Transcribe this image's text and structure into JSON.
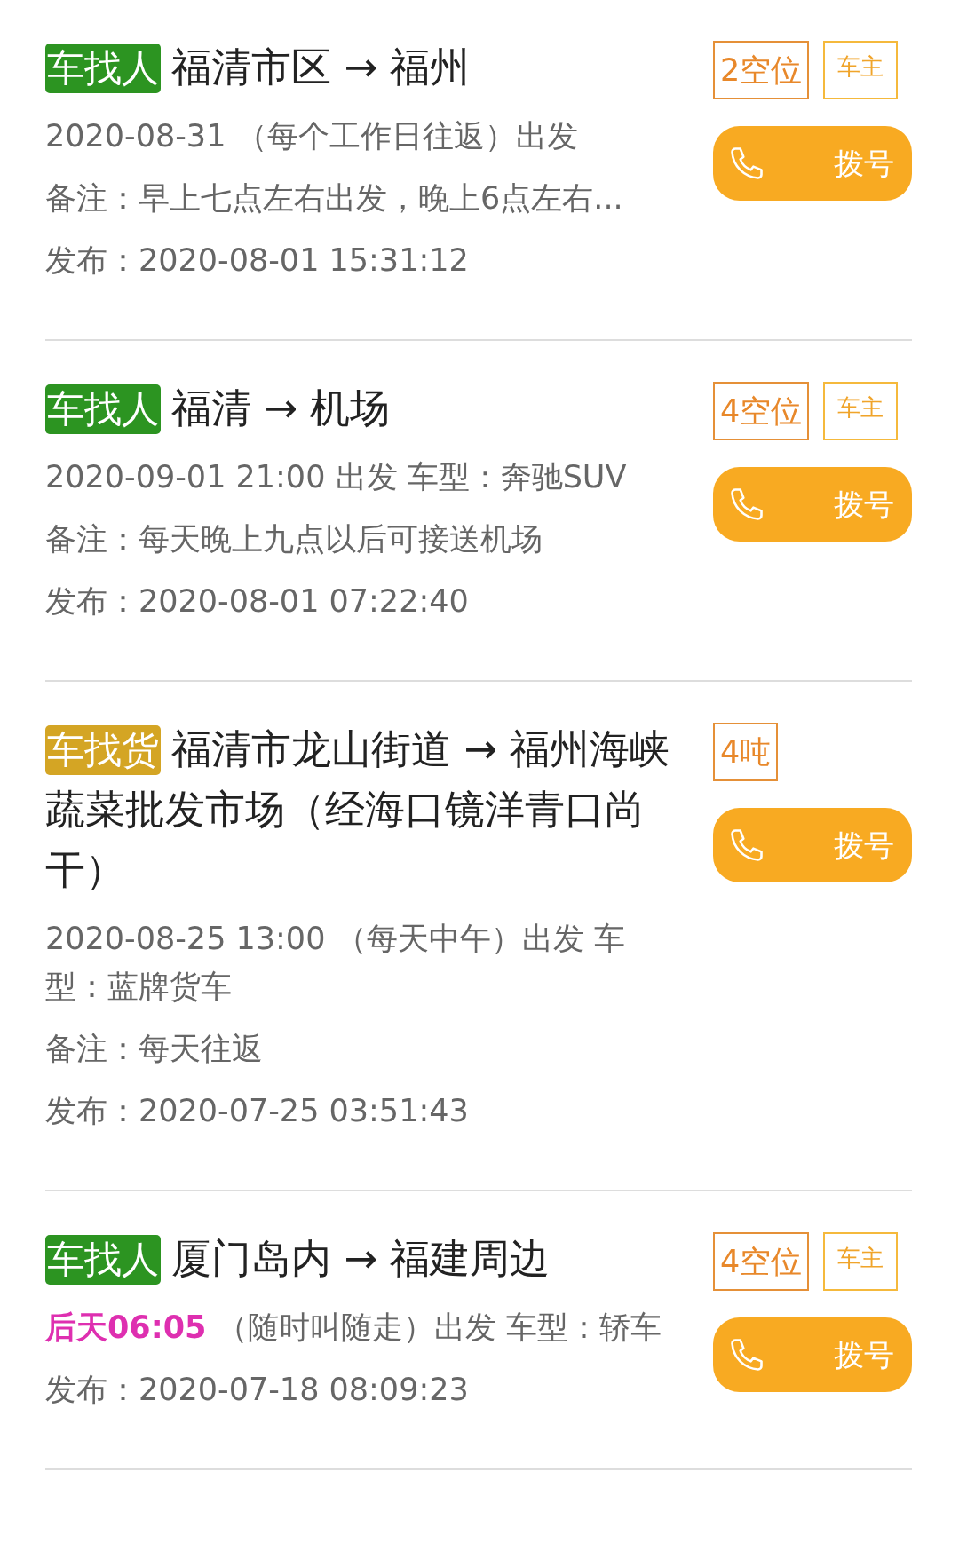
{
  "listings": [
    {
      "tag": {
        "text": "车找人",
        "kind": "passenger"
      },
      "route": "福清市区 → 福州",
      "badges": [
        {
          "text": "2空位",
          "kind": "capacity"
        },
        {
          "text": "车主",
          "kind": "role"
        }
      ],
      "dial": "拨号",
      "lines": [
        {
          "text": "2020-08-31 （每个工作日往返）出发"
        },
        {
          "text": "备注：早上七点左右出发，晚上6点左右..."
        },
        {
          "text": "发布：2020-08-01 15:31:12"
        }
      ]
    },
    {
      "tag": {
        "text": "车找人",
        "kind": "passenger"
      },
      "route": "福清 → 机场",
      "badges": [
        {
          "text": "4空位",
          "kind": "capacity"
        },
        {
          "text": "车主",
          "kind": "role"
        }
      ],
      "dial": "拨号",
      "lines": [
        {
          "text": "2020-09-01 21:00 出发 车型：奔驰SUV"
        },
        {
          "text": "备注：每天晚上九点以后可接送机场"
        },
        {
          "text": "发布：2020-08-01 07:22:40"
        }
      ]
    },
    {
      "tag": {
        "text": "车找货",
        "kind": "cargo"
      },
      "route": "福清市龙山街道 → 福州海峡蔬菜批发市场（经海口镜洋青口尚干）",
      "badges": [
        {
          "text": "4吨",
          "kind": "capacity"
        }
      ],
      "dial": "拨号",
      "lines": [
        {
          "text": "2020-08-25 13:00 （每天中午）出发 车型：蓝牌货车"
        },
        {
          "text": "备注：每天往返"
        },
        {
          "text": "发布：2020-07-25 03:51:43"
        }
      ]
    },
    {
      "tag": {
        "text": "车找人",
        "kind": "passenger"
      },
      "route": "厦门岛内 → 福建周边",
      "badges": [
        {
          "text": "4空位",
          "kind": "capacity"
        },
        {
          "text": "车主",
          "kind": "role"
        }
      ],
      "dial": "拨号",
      "lines": [
        {
          "lead": "后天06:05",
          "text": " （随时叫随走）出发 车型：轿车"
        },
        {
          "text": "发布：2020-07-18 08:09:23"
        }
      ]
    }
  ]
}
